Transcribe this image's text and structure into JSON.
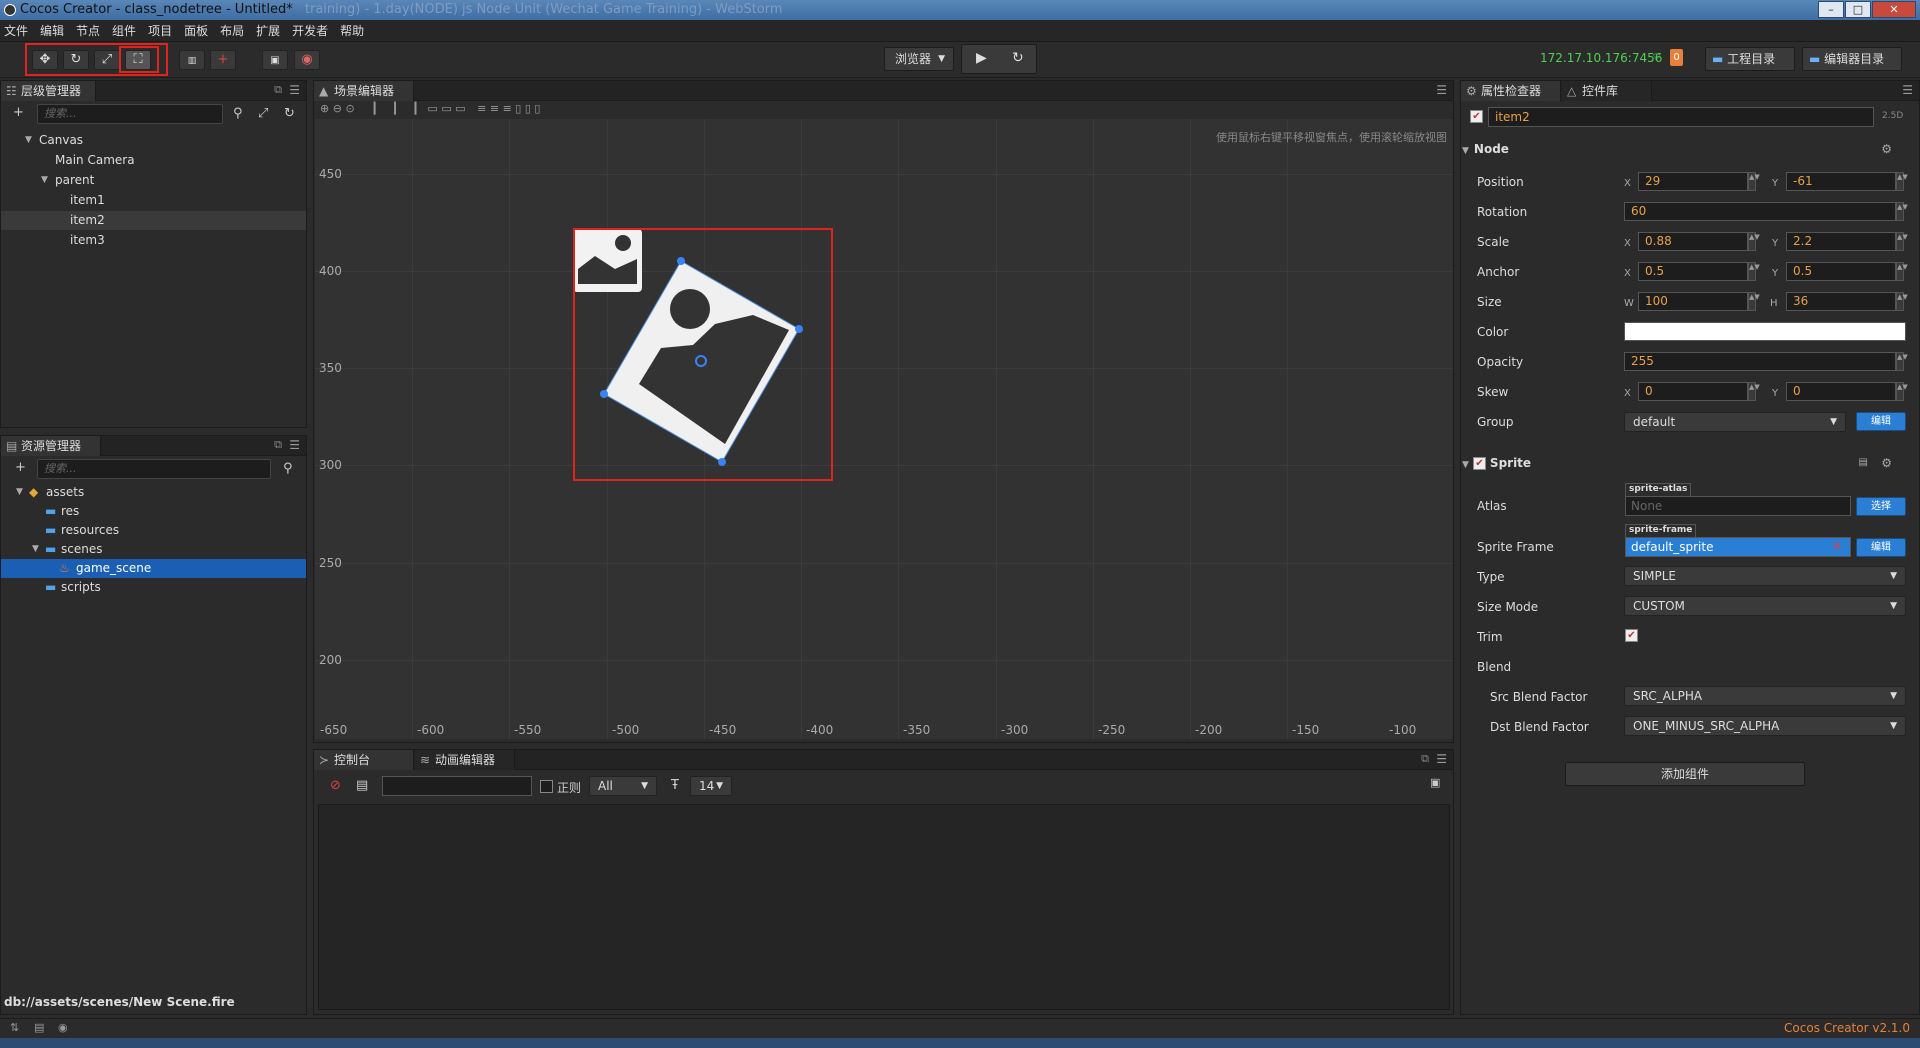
{
  "window": {
    "title": "Cocos Creator - class_nodetree - Untitled*",
    "title_blur": "training) - 1.day(NODE) js   Node   Unit   (Wechat Game Training) - WebStorm",
    "controls": {
      "minimize": "–",
      "maximize": "□",
      "close": "✕"
    }
  },
  "menubar": [
    "文件",
    "编辑",
    "节点",
    "组件",
    "项目",
    "面板",
    "布局",
    "扩展",
    "开发者",
    "帮助"
  ],
  "toolbar": {
    "transform_tools": [
      "move-icon",
      "rotate-icon",
      "scale-icon",
      "rect-icon"
    ],
    "preview_select": "浏览器",
    "ip": "172.17.10.176:7456",
    "badge": "0",
    "project_dir_button": "工程目录",
    "editor_dir_button": "编辑器目录"
  },
  "hierarchy": {
    "title": "层级管理器",
    "search_placeholder": "搜索...",
    "nodes": [
      "Canvas",
      "Main Camera",
      "parent",
      "item1",
      "item2",
      "item3"
    ]
  },
  "assets": {
    "title": "资源管理器",
    "search_placeholder": "搜索...",
    "items": [
      "assets",
      "res",
      "resources",
      "scenes",
      "game_scene",
      "scripts"
    ]
  },
  "scene": {
    "title": "场景编辑器",
    "hint": "使用鼠标右键平移视窗焦点，使用滚轮缩放视图",
    "y_labels": [
      "450",
      "400",
      "350",
      "300",
      "250",
      "200"
    ],
    "x_labels": [
      "-650",
      "-600",
      "-550",
      "-500",
      "-450",
      "-400",
      "-350",
      "-300",
      "-250",
      "-200",
      "-150",
      "-100"
    ]
  },
  "console": {
    "tab_console": "控制台",
    "tab_animation": "动画编辑器",
    "regex_label": "正则",
    "level": "All",
    "font_size": "14"
  },
  "inspector": {
    "tab_inspector": "属性检查器",
    "tab_widgets": "控件库",
    "node_name": "item2",
    "mode": "2.5D",
    "node_section": "Node",
    "labels": {
      "position": "Position",
      "rotation": "Rotation",
      "scale": "Scale",
      "anchor": "Anchor",
      "size": "Size",
      "color": "Color",
      "opacity": "Opacity",
      "skew": "Skew",
      "group": "Group"
    },
    "axis": {
      "x": "X",
      "y": "Y",
      "w": "W",
      "h": "H"
    },
    "position": {
      "x": "29",
      "y": "-61"
    },
    "rotation": "60",
    "scale": {
      "x": "0.88",
      "y": "2.2"
    },
    "anchor": {
      "x": "0.5",
      "y": "0.5"
    },
    "size": {
      "w": "100",
      "h": "36"
    },
    "color": "#ffffff",
    "opacity": "255",
    "skew": {
      "x": "0",
      "y": "0"
    },
    "group": "default",
    "edit_button": "编辑",
    "sprite_section": "Sprite",
    "sprite_labels": {
      "atlas": "Atlas",
      "sprite_frame": "Sprite Frame",
      "type": "Type",
      "size_mode": "Size Mode",
      "trim": "Trim",
      "blend": "Blend",
      "src_blend": "Src Blend Factor",
      "dst_blend": "Dst Blend Factor"
    },
    "atlas_tag": "sprite-atlas",
    "atlas_value": "None",
    "select_button": "选择",
    "frame_tag": "sprite-frame",
    "frame_value": "default_sprite",
    "type": "SIMPLE",
    "size_mode": "CUSTOM",
    "trim": true,
    "src_blend": "SRC_ALPHA",
    "dst_blend": "ONE_MINUS_SRC_ALPHA",
    "add_component": "添加组件"
  },
  "status": {
    "path": "db://assets/scenes/New Scene.fire",
    "version": "Cocos Creator v2.1.0"
  },
  "colors": {
    "accent_blue": "#2a7fd4",
    "highlight_red": "#e0241d",
    "value_orange": "#e6a14a",
    "ip_green": "#4fd04f"
  }
}
